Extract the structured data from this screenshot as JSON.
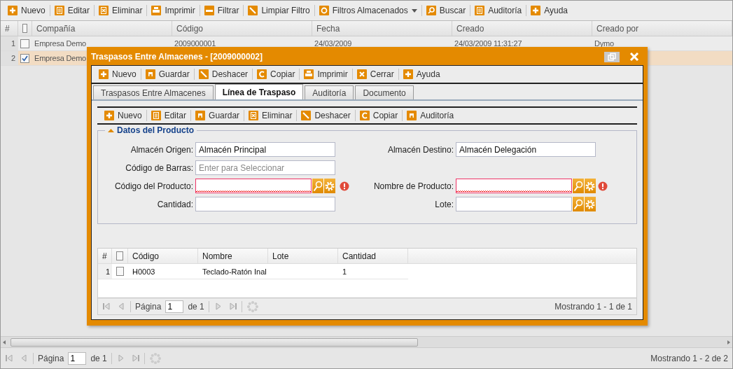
{
  "main_toolbar": [
    {
      "label": "Nuevo",
      "kind": "button"
    },
    {
      "label": "Editar",
      "kind": "button"
    },
    {
      "label": "Eliminar",
      "kind": "button"
    },
    {
      "label": "Imprimir",
      "kind": "button"
    },
    {
      "label": "Filtrar",
      "kind": "button"
    },
    {
      "label": "Limpiar Filtro",
      "kind": "button"
    },
    {
      "label": "Filtros Almacenados",
      "kind": "menu"
    },
    {
      "label": "Buscar",
      "kind": "button"
    },
    {
      "label": "Auditoría",
      "kind": "button"
    },
    {
      "label": "Ayuda",
      "kind": "button"
    }
  ],
  "grid": {
    "number_header": "#",
    "all_checked": false,
    "columns": [
      "Compañía",
      "Código",
      "Fecha",
      "Creado",
      "Creado por"
    ],
    "rows": [
      {
        "number": "1",
        "checked": false,
        "selected": false,
        "cells": [
          "Empresa Demo",
          "2009000001",
          "24/03/2009",
          "24/03/2009 11:31:27",
          "Dymo"
        ]
      },
      {
        "number": "2",
        "checked": true,
        "selected": true,
        "cells": [
          "Empresa Demo"
        ]
      }
    ]
  },
  "grid_pager": {
    "page_label": "Página",
    "page": "1",
    "of": "de 1",
    "status": "Mostrando 1 - 2 de 2"
  },
  "dialog": {
    "title": "Traspasos Entre Almacenes - [2009000002]",
    "toolbar": [
      {
        "label": "Nuevo"
      },
      {
        "label": "Guardar"
      },
      {
        "label": "Deshacer"
      },
      {
        "label": "Copiar"
      },
      {
        "label": "Imprimir"
      },
      {
        "label": "Cerrar"
      },
      {
        "label": "Ayuda"
      }
    ],
    "tabs": [
      {
        "label": "Traspasos Entre Almacenes",
        "selected": false
      },
      {
        "label": "Línea de Traspaso",
        "selected": true
      },
      {
        "label": "Auditoría",
        "selected": false
      },
      {
        "label": "Documento",
        "selected": false
      }
    ],
    "sub_toolbar": [
      {
        "label": "Nuevo"
      },
      {
        "label": "Editar"
      },
      {
        "label": "Guardar"
      },
      {
        "label": "Eliminar"
      },
      {
        "label": "Deshacer"
      },
      {
        "label": "Copiar"
      },
      {
        "label": "Auditoría"
      }
    ],
    "fieldset": {
      "title": "Datos del Producto",
      "expanded": true
    },
    "form_rows": [
      {
        "left": {
          "label": "Almacén Origen:",
          "value": "Almacén Principal",
          "invalid": false,
          "lookup": false
        },
        "right": {
          "label": "Almacén Destino:",
          "value": "Almacén Delegación",
          "invalid": false,
          "lookup": false
        }
      },
      {
        "left": {
          "label": "Código de Barras:",
          "placeholder": "Enter para Seleccionar",
          "invalid": false,
          "lookup": false
        }
      },
      {
        "left": {
          "label": "Código del Producto:",
          "invalid": true,
          "lookup": true
        },
        "right": {
          "label": "Nombre de Producto:",
          "invalid": true,
          "lookup": true
        }
      },
      {
        "left": {
          "label": "Cantidad:",
          "invalid": false,
          "lookup": false
        },
        "right": {
          "label": "Lote:",
          "invalid": false,
          "lookup": true
        }
      }
    ],
    "lines": {
      "number_header": "#",
      "all_checked": false,
      "columns": [
        "Código",
        "Nombre",
        "Lote",
        "Cantidad"
      ],
      "rows": [
        {
          "number": "1",
          "checked": false,
          "code": "H0003",
          "name": "Teclado-Ratón Inal",
          "quantity": "1"
        }
      ]
    },
    "pager": {
      "page_label": "Página",
      "page": "1",
      "of": "de 1",
      "status": "Mostrando 1 - 1 de 1"
    }
  }
}
